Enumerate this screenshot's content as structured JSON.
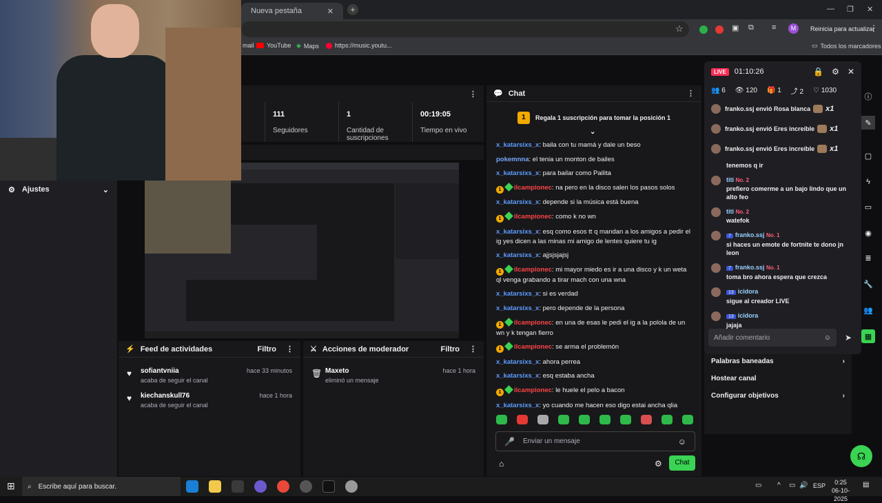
{
  "browser": {
    "tab_title": "Nueva pestaña",
    "update_label": "Reinicia para actualizar",
    "profile_initial": "M",
    "bookmarks": [
      "mail",
      "YouTube",
      "Maps",
      "https://music.youtu..."
    ],
    "all_bookmarks": "Todos los marcadores"
  },
  "stats": [
    {
      "value": "111",
      "label": "Seguidores"
    },
    {
      "value": "1",
      "label": "Cantidad de suscripciones"
    },
    {
      "value": "00:19:05",
      "label": "Tiempo en vivo"
    }
  ],
  "settings_label": "Ajustes",
  "activity_feed": {
    "title": "Feed de actividades",
    "filter": "Filtro",
    "items": [
      {
        "name": "sofiantvniia",
        "desc": "acaba de seguir el canal",
        "time": "hace 33 minutos"
      },
      {
        "name": "kiechanskull76",
        "desc": "acaba de seguir el canal",
        "time": "hace 1 hora"
      }
    ]
  },
  "mod_actions": {
    "title": "Acciones de moderador",
    "filter": "Filtro",
    "items": [
      {
        "name": "Maxeto",
        "desc": "eliminó un mensaje",
        "time": "hace 1 hora"
      }
    ]
  },
  "chat": {
    "title": "Chat",
    "gift_banner": "Regala 1 suscripción para tomar la posición 1",
    "gift_rank": "1",
    "messages": [
      {
        "user": "x_katarsixs_x",
        "text": ": baila con tu mamá y dale un beso",
        "type": "plain"
      },
      {
        "user": "pokemnna",
        "text": ": el tenia un monton de bailes",
        "type": "plain"
      },
      {
        "user": "x_katarsixs_x",
        "text": ": para bailar como Pailita",
        "type": "plain"
      },
      {
        "user": "ilcampionec",
        "text": ": na pero en la disco salen los pasos solos",
        "type": "badge"
      },
      {
        "user": "x_katarsixs_x",
        "text": ": depende si la música está buena",
        "type": "plain"
      },
      {
        "user": "ilcampionec",
        "text": ": como k no wn",
        "type": "badge"
      },
      {
        "user": "x_katarsixs_x",
        "text": ": esq como esos tt q mandan a los amigos a pedir el ig yes dicen a las minas mi amigo de lentes quiere tu ig",
        "type": "plain"
      },
      {
        "user": "x_katarsixs_x",
        "text": ": ajjsjsjajsj",
        "type": "plain"
      },
      {
        "user": "ilcampionec",
        "text": ": mi mayor miedo es ir a una disco y k un weta ql venga grabando a tirar mach con una wna",
        "type": "badge"
      },
      {
        "user": "x_katarsixs_x",
        "text": ": si es verdad",
        "type": "plain"
      },
      {
        "user": "x_katarsixs_x",
        "text": ": pero depende de la persona",
        "type": "plain"
      },
      {
        "user": "ilcampionec",
        "text": ": en una de esas le pedi el ig a la polola de un wn y k tengan fierro",
        "type": "badge"
      },
      {
        "user": "ilcampionec",
        "text": ": se arma el problemón",
        "type": "badge"
      },
      {
        "user": "x_katarsixs_x",
        "text": ": ahora perrea",
        "type": "plain"
      },
      {
        "user": "x_katarsixs_x",
        "text": ": esq estaba ancha",
        "type": "plain"
      },
      {
        "user": "ilcampionec",
        "text": ": le huele el pelo a bacon",
        "type": "badge"
      },
      {
        "user": "x_katarsixs_x",
        "text": ": yo cuando me hacen eso digo estai ancha qlia",
        "type": "plain"
      }
    ],
    "input_placeholder": "Enviar un mensaje",
    "send_label": "Chat"
  },
  "live_panel": {
    "live_label": "LIVE",
    "timer": "01:10:26",
    "counts": [
      "6",
      "120",
      "1",
      "2",
      "1030"
    ],
    "gifts": [
      {
        "user": "franko.ssj",
        "text": "envió Rosa blanca",
        "qty": "x1"
      },
      {
        "user": "franko.ssj",
        "text": "envió Eres increíble",
        "qty": "x1"
      },
      {
        "user": "franko.ssj",
        "text": "envió Eres increíble",
        "qty": "x1"
      }
    ],
    "comments": [
      {
        "user": "",
        "badge": "",
        "text": "tenemos q ir"
      },
      {
        "user": "titi",
        "badge": "No. 2",
        "text": "prefiero comerme a un bajo lindo que un alto feo"
      },
      {
        "user": "titi",
        "badge": "No. 2",
        "text": "watefok"
      },
      {
        "user": "franko.ssj",
        "badge": "No. 1",
        "level": "7",
        "text": "si haces un emote de fortnite te dono jn leon"
      },
      {
        "user": "franko.ssj",
        "badge": "No. 1",
        "level": "7",
        "text": "toma bro ahora espera que crezca"
      },
      {
        "user": "icidora",
        "badge": "",
        "level": "13",
        "text": "sigue al creador LIVE"
      },
      {
        "user": "icidora",
        "badge": "",
        "level": "13",
        "text": "jajaja"
      }
    ],
    "comment_placeholder": "Añadir comentario"
  },
  "side_menu": [
    "Palabras baneadas",
    "Hostear canal",
    "Configurar objetivos"
  ],
  "taskbar": {
    "search_placeholder": "Escribe aquí para buscar.",
    "lang": "ESP",
    "time": "0:25",
    "date": "06-10-2025"
  }
}
